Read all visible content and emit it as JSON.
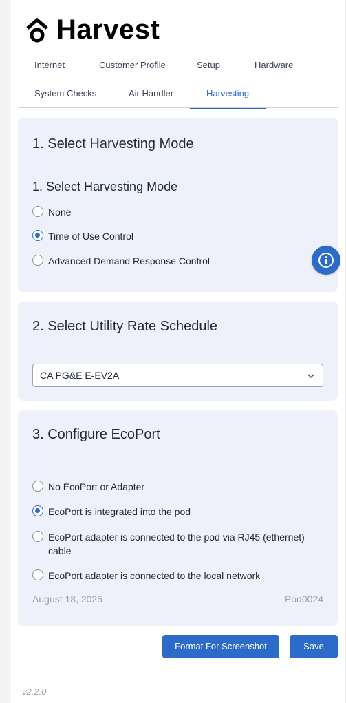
{
  "brand": {
    "name": "Harvest"
  },
  "tabs": {
    "row1": [
      "Internet",
      "Customer Profile",
      "Setup",
      "Hardware"
    ],
    "row2": [
      "System Checks",
      "Air Handler",
      "Harvesting"
    ],
    "active": "Harvesting"
  },
  "harvesting_mode": {
    "card_title": "1. Select Harvesting Mode",
    "section_title": "1. Select Harvesting Mode",
    "options": [
      "None",
      "Time of Use Control",
      "Advanced Demand Response Control"
    ],
    "selected": "Time of Use Control"
  },
  "rate_schedule": {
    "card_title": "2. Select Utility Rate Schedule",
    "selected": "CA PG&E E-EV2A"
  },
  "ecoport": {
    "card_title": "3. Configure EcoPort",
    "options": [
      "No EcoPort or Adapter",
      "EcoPort is integrated into the pod",
      "EcoPort adapter is connected to the pod via RJ45 (ethernet) cable",
      "EcoPort adapter is connected to the local network"
    ],
    "selected": "EcoPort is integrated into the pod",
    "date": "August 18, 2025",
    "pod_id": "Pod0024"
  },
  "actions": {
    "format_label": "Format For Screenshot",
    "save_label": "Save"
  },
  "footer": {
    "version": "v2.2.0"
  },
  "colors": {
    "accent": "#2d6bc9",
    "card_bg": "#eef0fa"
  },
  "icons": {
    "logo": "house-arrow-icon",
    "info": "info-icon",
    "select": "chevron-down-icon"
  }
}
